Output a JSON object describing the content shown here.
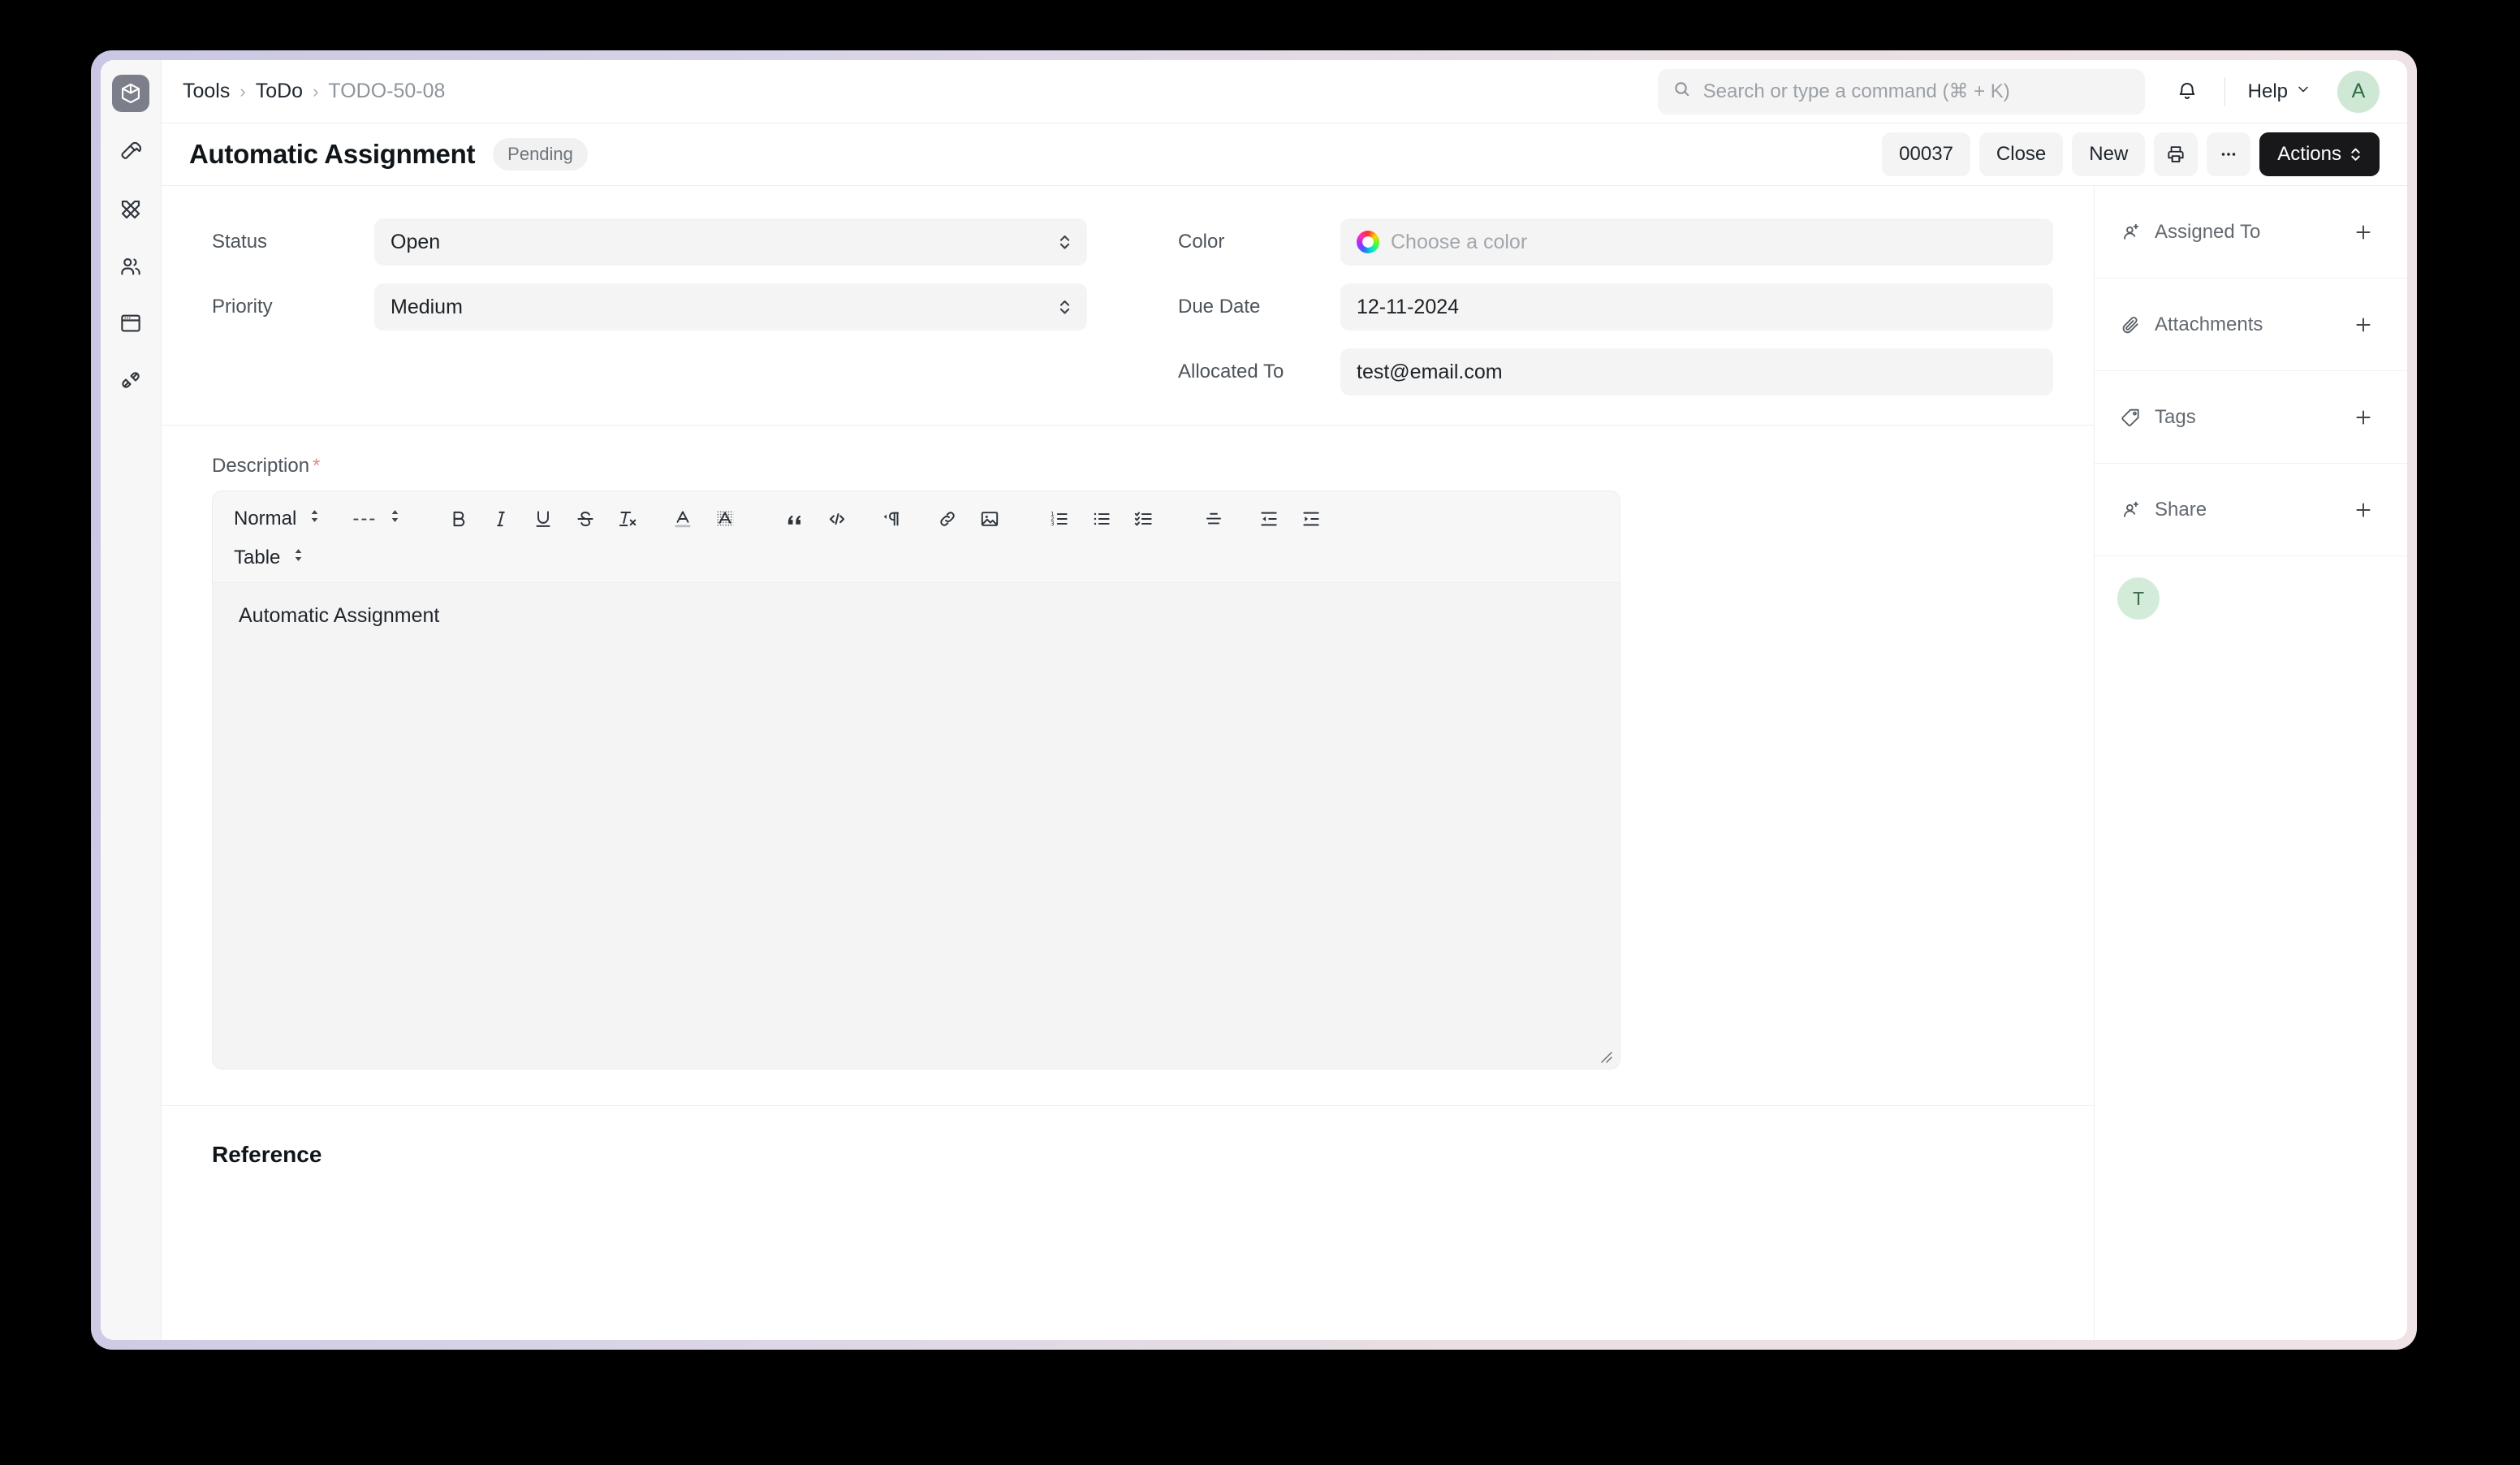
{
  "rail": {
    "logo_icon": "cube-logo-icon",
    "items": [
      {
        "icon": "hammer-icon",
        "name": "tools"
      },
      {
        "icon": "pencil-ruler-icon",
        "name": "build"
      },
      {
        "icon": "users-icon",
        "name": "users"
      },
      {
        "icon": "window-icon",
        "name": "website"
      },
      {
        "icon": "plug-icon",
        "name": "integrations"
      }
    ]
  },
  "navbar": {
    "breadcrumb": [
      {
        "label": "Tools",
        "current": false
      },
      {
        "label": "ToDo",
        "current": false
      },
      {
        "label": "TODO-50-08",
        "current": true
      }
    ],
    "separator": "›",
    "search": {
      "placeholder": "Search or type a command (⌘ + K)",
      "value": "",
      "icon": "search-icon"
    },
    "bell_icon": "notification-bell-icon",
    "help_label": "Help",
    "help_chevron": "chevron-down-icon",
    "avatar_initial": "A"
  },
  "page_head": {
    "title": "Automatic Assignment",
    "status": "Pending",
    "buttons": {
      "counter": "00037",
      "close": "Close",
      "new": "New",
      "print_icon": "printer-icon",
      "more_icon": "ellipsis-icon",
      "actions": "Actions"
    }
  },
  "form": {
    "left": [
      {
        "label": "Status",
        "value": "Open",
        "type": "select"
      },
      {
        "label": "Priority",
        "value": "Medium",
        "type": "select"
      }
    ],
    "right": [
      {
        "label": "Color",
        "value": "",
        "placeholder": "Choose a color",
        "type": "color"
      },
      {
        "label": "Due Date",
        "value": "12-11-2024",
        "type": "date"
      },
      {
        "label": "Allocated To",
        "value": "test@email.com",
        "type": "text"
      }
    ]
  },
  "description": {
    "label": "Description",
    "required_mark": "*",
    "toolbar": {
      "style_select": "Normal",
      "font_select": "---",
      "table_select": "Table",
      "buttons": [
        {
          "icon": "bold-icon",
          "label": "B"
        },
        {
          "icon": "italic-icon",
          "label": "I"
        },
        {
          "icon": "underline-icon",
          "label": "U"
        },
        {
          "icon": "strikethrough-icon",
          "label": "S"
        },
        {
          "icon": "clear-format-icon",
          "label": "Tx"
        },
        {
          "icon": "font-color-icon",
          "label": "A"
        },
        {
          "icon": "highlight-color-icon",
          "label": "A"
        },
        {
          "icon": "blockquote-icon",
          "label": "”"
        },
        {
          "icon": "code-block-icon",
          "label": "</>"
        },
        {
          "icon": "text-direction-icon",
          "label": "¶"
        },
        {
          "icon": "link-icon",
          "label": "link"
        },
        {
          "icon": "image-icon",
          "label": "image"
        },
        {
          "icon": "ordered-list-icon",
          "label": "123"
        },
        {
          "icon": "bullet-list-icon",
          "label": "bullets"
        },
        {
          "icon": "checklist-icon",
          "label": "checks"
        },
        {
          "icon": "align-icon",
          "label": "align"
        },
        {
          "icon": "outdent-icon",
          "label": "outdent"
        },
        {
          "icon": "indent-icon",
          "label": "indent"
        }
      ]
    },
    "content": "Automatic Assignment"
  },
  "reference": {
    "title": "Reference"
  },
  "sidebar": {
    "rows": [
      {
        "label": "Assigned To",
        "icon": "assign-user-icon",
        "action_icon": "plus-icon"
      },
      {
        "label": "Attachments",
        "icon": "paperclip-icon",
        "action_icon": "plus-icon"
      },
      {
        "label": "Tags",
        "icon": "tag-icon",
        "action_icon": "plus-icon"
      },
      {
        "label": "Share",
        "icon": "share-user-icon",
        "action_icon": "plus-icon"
      }
    ],
    "avatars": [
      {
        "initial": "T"
      }
    ]
  },
  "colors": {
    "accent_dark": "#18181b",
    "avatar_green_bg": "#cfe8d5",
    "avatar_green_fg": "#2f6b43",
    "field_bg": "#f4f4f5",
    "required_red": "#e08b8b",
    "frame_gradient_start": "#c9c7e4",
    "frame_gradient_end": "#f0e3e5"
  }
}
